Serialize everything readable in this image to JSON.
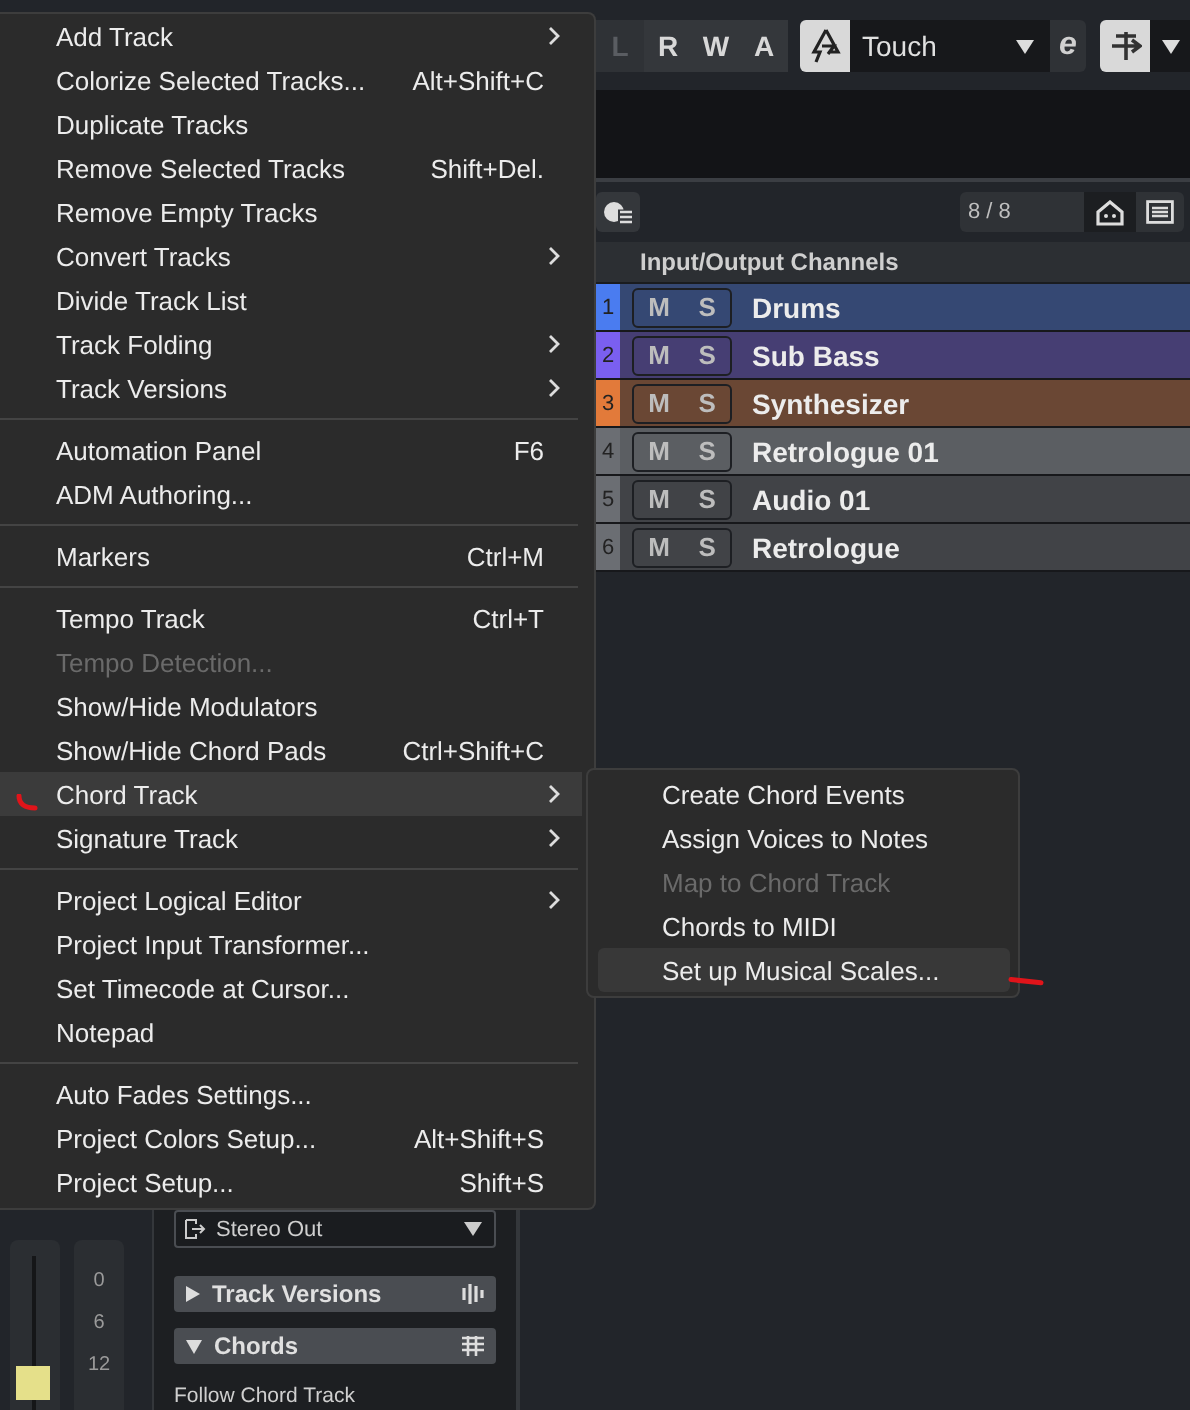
{
  "toolbar": {
    "automation_buttons": [
      {
        "label": "L",
        "disabled": true
      },
      {
        "label": "R",
        "disabled": false
      },
      {
        "label": "W",
        "disabled": false
      },
      {
        "label": "A",
        "disabled": false
      }
    ],
    "automation_mode": "Touch",
    "e_button": "e"
  },
  "mixer": {
    "counter": "8 / 8",
    "header": "Input/Output Channels",
    "channels": [
      {
        "number": "1",
        "mute": "M",
        "solo": "S",
        "name": "Drums",
        "color": "#4a7cf0",
        "selected": false
      },
      {
        "number": "2",
        "mute": "M",
        "solo": "S",
        "name": "Sub Bass",
        "color": "#7a5ff0",
        "selected": false
      },
      {
        "number": "3",
        "mute": "M",
        "solo": "S",
        "name": "Synthesizer",
        "color": "#e27a3a",
        "selected": false
      },
      {
        "number": "4",
        "mute": "M",
        "solo": "S",
        "name": "Retrologue 01",
        "color": "#6b6e73",
        "selected": true
      },
      {
        "number": "5",
        "mute": "M",
        "solo": "S",
        "name": "Audio 01",
        "color": "#6b6e73",
        "selected": false
      },
      {
        "number": "6",
        "mute": "M",
        "solo": "S",
        "name": "Retrologue",
        "color": "#6b6e73",
        "selected": false
      }
    ]
  },
  "fader": {
    "scale": [
      "0",
      "6",
      "12"
    ],
    "level": 0.15
  },
  "inspector": {
    "output": "Stereo Out",
    "sections": [
      {
        "title": "Track Versions",
        "expanded": false
      },
      {
        "title": "Chords",
        "expanded": true
      }
    ],
    "option": "Follow Chord Track"
  },
  "menu": {
    "sections": [
      [
        {
          "label": "Add Track",
          "submenu": true,
          "disabled": false,
          "selected": false
        },
        {
          "label": "Colorize Selected Tracks...",
          "shortcut": "Alt+Shift+C",
          "submenu": false,
          "disabled": false,
          "selected": false
        },
        {
          "label": "Duplicate Tracks",
          "submenu": false,
          "disabled": false,
          "selected": false
        },
        {
          "label": "Remove Selected Tracks",
          "shortcut": "Shift+Del.",
          "submenu": false,
          "disabled": false,
          "selected": false
        },
        {
          "label": "Remove Empty Tracks",
          "submenu": false,
          "disabled": false,
          "selected": false
        },
        {
          "label": "Convert Tracks",
          "submenu": true,
          "disabled": false,
          "selected": false
        },
        {
          "label": "Divide Track List",
          "submenu": false,
          "disabled": false,
          "selected": false
        },
        {
          "label": "Track Folding",
          "submenu": true,
          "disabled": false,
          "selected": false
        },
        {
          "label": "Track Versions",
          "submenu": true,
          "disabled": false,
          "selected": false
        }
      ],
      [
        {
          "label": "Automation Panel",
          "shortcut": "F6",
          "submenu": false,
          "disabled": false,
          "selected": false
        },
        {
          "label": "ADM Authoring...",
          "submenu": false,
          "disabled": false,
          "selected": false
        }
      ],
      [
        {
          "label": "Markers",
          "shortcut": "Ctrl+M",
          "submenu": false,
          "disabled": false,
          "selected": false
        }
      ],
      [
        {
          "label": "Tempo Track",
          "shortcut": "Ctrl+T",
          "submenu": false,
          "disabled": false,
          "selected": false
        },
        {
          "label": "Tempo Detection...",
          "submenu": false,
          "disabled": true,
          "selected": false
        },
        {
          "label": "Show/Hide Modulators",
          "submenu": false,
          "disabled": false,
          "selected": false
        },
        {
          "label": "Show/Hide Chord Pads",
          "shortcut": "Ctrl+Shift+C",
          "submenu": false,
          "disabled": false,
          "selected": false
        },
        {
          "label": "Chord Track",
          "submenu": true,
          "disabled": false,
          "selected": true
        },
        {
          "label": "Signature Track",
          "submenu": true,
          "disabled": false,
          "selected": false
        }
      ],
      [
        {
          "label": "Project Logical Editor",
          "submenu": true,
          "disabled": false,
          "selected": false
        },
        {
          "label": "Project Input Transformer...",
          "submenu": false,
          "disabled": false,
          "selected": false
        },
        {
          "label": "Set Timecode at Cursor...",
          "submenu": false,
          "disabled": false,
          "selected": false
        },
        {
          "label": "Notepad",
          "submenu": false,
          "disabled": false,
          "selected": false
        }
      ],
      [
        {
          "label": "Auto Fades Settings...",
          "submenu": false,
          "disabled": false,
          "selected": false
        },
        {
          "label": "Project Colors Setup...",
          "shortcut": "Alt+Shift+S",
          "submenu": false,
          "disabled": false,
          "selected": false
        },
        {
          "label": "Project Setup...",
          "shortcut": "Shift+S",
          "submenu": false,
          "disabled": false,
          "selected": false
        }
      ]
    ]
  },
  "submenu": {
    "items": [
      {
        "label": "Create Chord Events",
        "disabled": false,
        "selected": false
      },
      {
        "label": "Assign Voices to Notes",
        "disabled": false,
        "selected": false
      },
      {
        "label": "Map to Chord Track",
        "disabled": true,
        "selected": false
      },
      {
        "label": "Chords to MIDI",
        "disabled": false,
        "selected": false
      },
      {
        "label": "Set up Musical Scales...",
        "disabled": false,
        "selected": true
      }
    ]
  }
}
